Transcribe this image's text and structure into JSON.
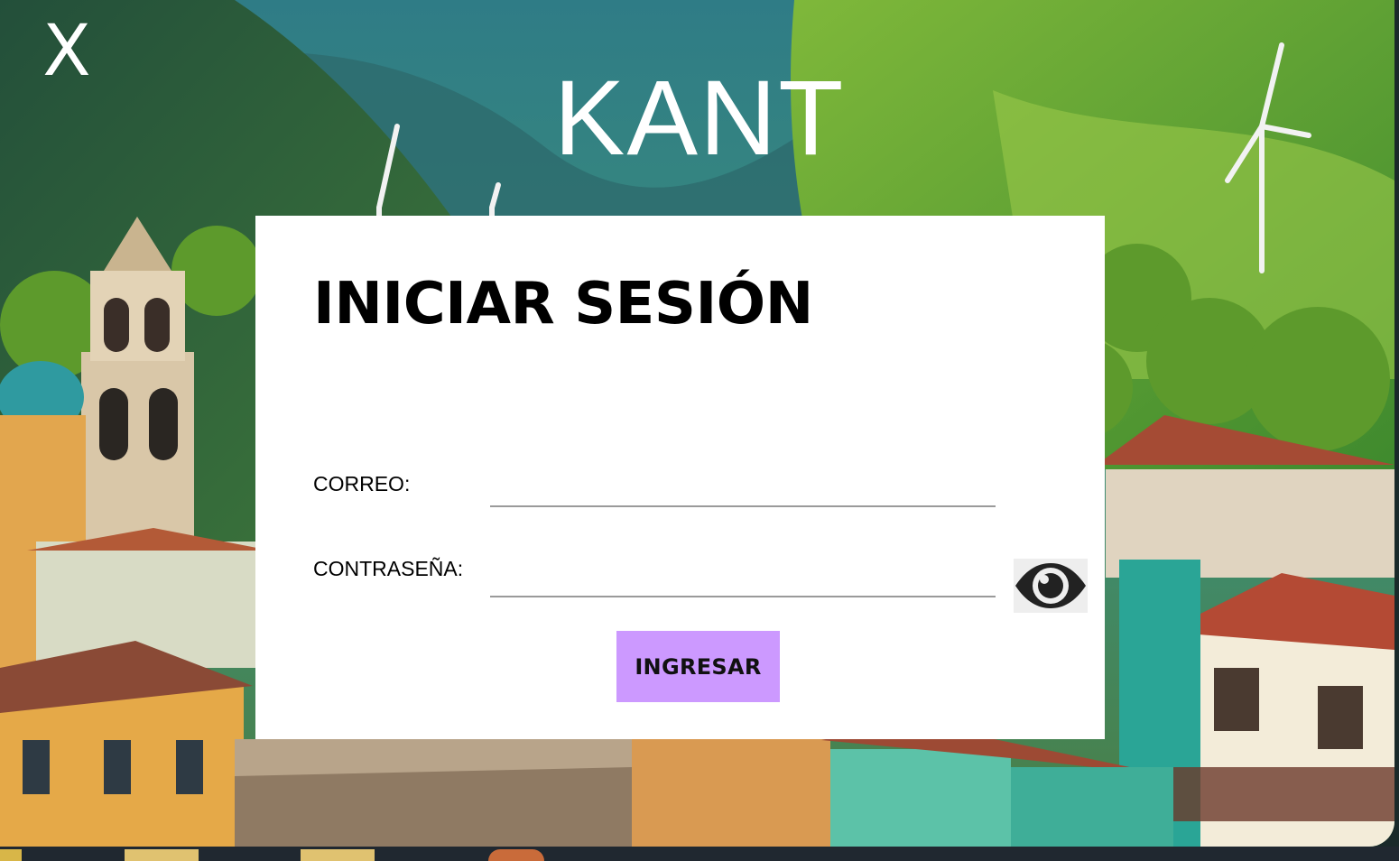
{
  "window": {
    "close_label": "X",
    "app_title": "KANT"
  },
  "login": {
    "heading": "INICIAR SESIÓN",
    "email_label": "CORREO:",
    "email_value": "",
    "password_label": "CONTRASEÑA:",
    "password_value": "",
    "toggle_icon": "eye-icon",
    "submit_label": "INGRESAR"
  },
  "colors": {
    "card_background": "#ffffff",
    "submit_button": "#cc99ff",
    "input_underline": "#9a9a9a",
    "title_text": "#ffffff"
  },
  "background_image": "illustrated colonial town with colorful houses, church bell towers and wind turbines on green mountains"
}
